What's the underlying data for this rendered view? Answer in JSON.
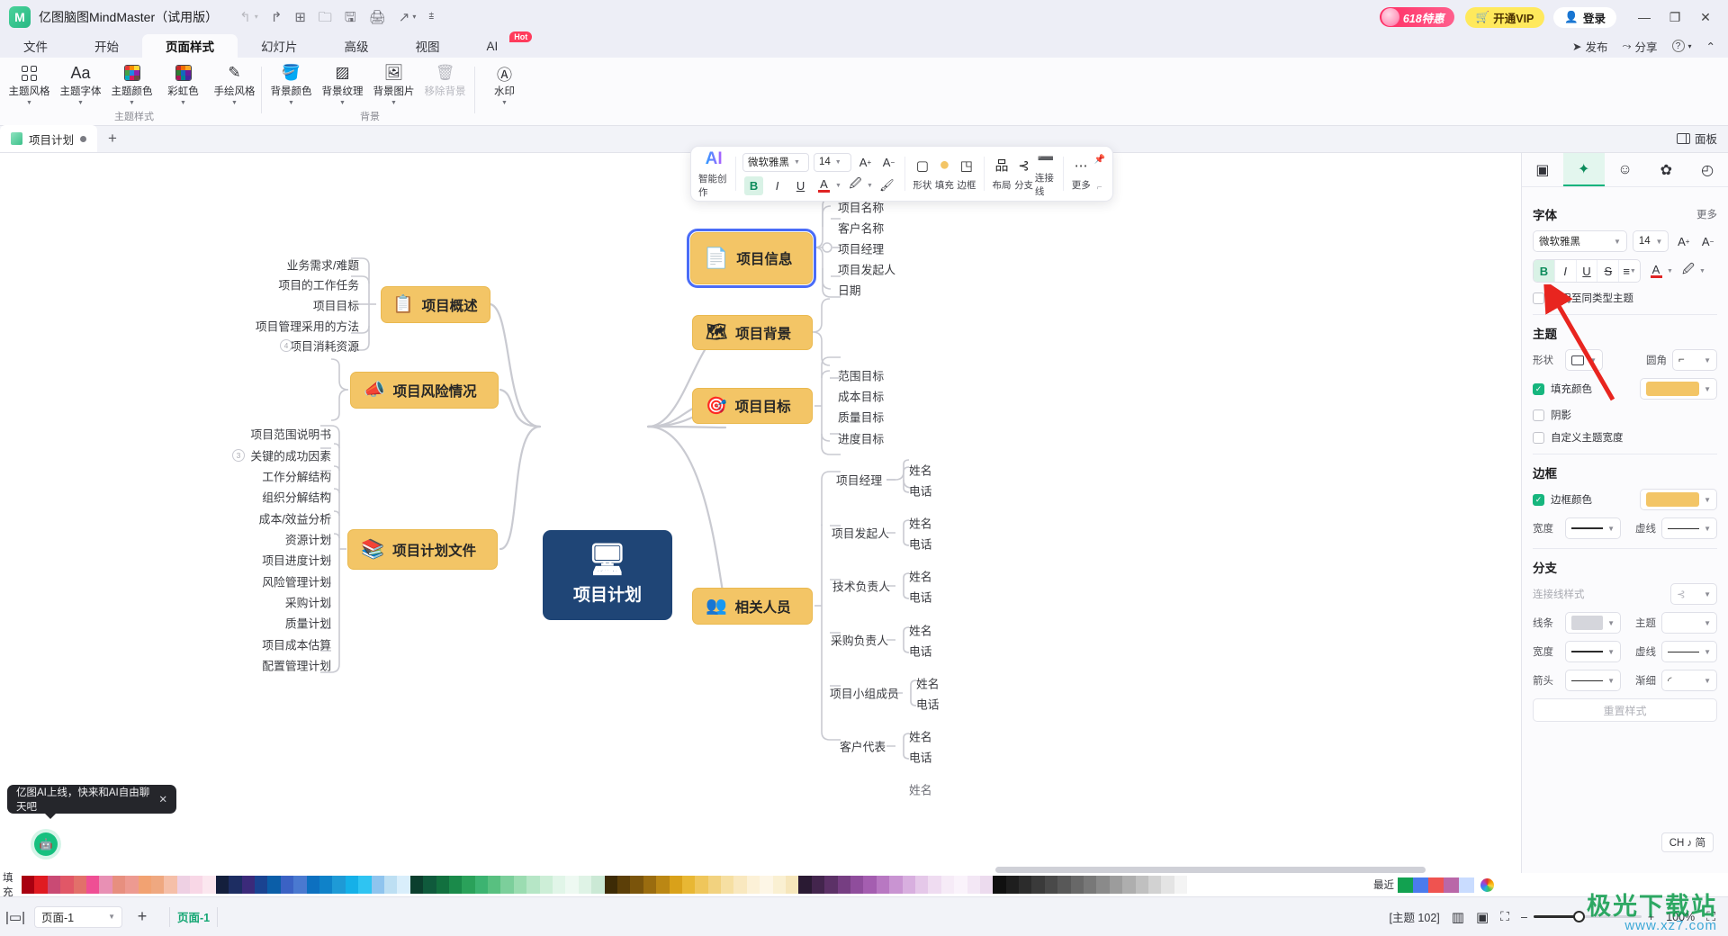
{
  "titlebar": {
    "app_title": "亿图脑图MindMaster（试用版）",
    "logo_glyph": "M",
    "quick_access": [
      {
        "name": "undo",
        "glyph": "↰"
      },
      {
        "name": "undo-dropdown",
        "glyph": "▾"
      },
      {
        "name": "redo",
        "glyph": "↱"
      },
      {
        "name": "new",
        "glyph": "⊞"
      },
      {
        "name": "open",
        "glyph": "🗀"
      },
      {
        "name": "save",
        "glyph": "🖫"
      },
      {
        "name": "print",
        "glyph": "🖨"
      },
      {
        "name": "export",
        "glyph": "↗"
      },
      {
        "name": "export-dropdown",
        "glyph": "▾"
      },
      {
        "name": "more",
        "glyph": "⩲"
      }
    ],
    "promo_badge": "618特惠",
    "vip_button": "开通VIP",
    "vip_icon": "🛒",
    "login_button": "登录",
    "login_icon": "👤",
    "minimize": "—",
    "maximize": "❐",
    "close": "✕"
  },
  "ribbon": {
    "tabs": [
      {
        "label": "文件",
        "active": false
      },
      {
        "label": "开始",
        "active": false
      },
      {
        "label": "页面样式",
        "active": true
      },
      {
        "label": "幻灯片",
        "active": false
      },
      {
        "label": "高级",
        "active": false
      },
      {
        "label": "视图",
        "active": false
      }
    ],
    "ai_tab": {
      "label": "AI",
      "badge": "Hot"
    },
    "right_actions": [
      {
        "label": "发布",
        "icon": "➤"
      },
      {
        "label": "分享",
        "icon": "⤳"
      },
      {
        "label": "",
        "icon": "?"
      },
      {
        "label": "",
        "icon": "▾"
      },
      {
        "label": "",
        "icon": "⌃"
      }
    ],
    "groups": [
      {
        "label": "主题样式",
        "items": [
          {
            "label": "主题风格",
            "icon": "grid-icon",
            "caret": true
          },
          {
            "label": "主题字体",
            "icon": "Aa",
            "caret": true
          },
          {
            "label": "主题颜色",
            "icon": "palette-icon",
            "caret": true
          },
          {
            "label": "彩虹色",
            "icon": "rainbow-icon",
            "caret": true
          },
          {
            "label": "手绘风格",
            "icon": "✎",
            "caret": true
          }
        ]
      },
      {
        "label": "背景",
        "items": [
          {
            "label": "背景颜色",
            "icon": "🪣",
            "caret": true
          },
          {
            "label": "背景纹理",
            "icon": "▨",
            "caret": true
          },
          {
            "label": "背景图片",
            "icon": "🖼",
            "caret": true
          },
          {
            "label": "移除背景",
            "icon": "🗑",
            "caret": false,
            "disabled": true
          }
        ]
      },
      {
        "label": "",
        "items": [
          {
            "label": "水印",
            "icon": "Ⓐ",
            "caret": true
          }
        ]
      }
    ]
  },
  "doctabs": {
    "tabs": [
      {
        "label": "项目计划",
        "modified": true
      }
    ],
    "add_label": "+",
    "panel_toggle": "面板"
  },
  "format_toolbar": {
    "ai_label": "AI",
    "ai_sub": "智能创作",
    "font_family": "微软雅黑",
    "font_size": "14",
    "increase_label": "A",
    "decrease_label": "A",
    "bold": "B",
    "italic": "I",
    "underline": "U",
    "font_color": "A",
    "font_color_hex": "#e02424",
    "highlight": "🖉",
    "painter": "🖌",
    "items": [
      {
        "label": "形状",
        "icon": "▢"
      },
      {
        "label": "填充",
        "icon": "●"
      },
      {
        "label": "边框",
        "icon": "◳"
      },
      {
        "label": "布局",
        "icon": "品"
      },
      {
        "label": "分支",
        "icon": "⊰"
      },
      {
        "label": "连接线",
        "icon": "➖"
      },
      {
        "label": "更多",
        "icon": "⋯"
      }
    ]
  },
  "right_panel": {
    "tabs": [
      {
        "name": "style",
        "icon": "▣",
        "active": false
      },
      {
        "name": "ai-sparkle",
        "icon": "✦",
        "active": true
      },
      {
        "name": "emoji",
        "icon": "☺",
        "active": false
      },
      {
        "name": "settings",
        "icon": "✿",
        "active": false
      },
      {
        "name": "history",
        "icon": "◴",
        "active": false
      }
    ],
    "font_section": {
      "title": "字体",
      "more": "更多",
      "family": "微软雅黑",
      "size": "14",
      "inc": "A",
      "dec": "A",
      "bold": "B",
      "italic": "I",
      "underline": "U",
      "strike": "S",
      "align": "≡",
      "color": "A",
      "highlight": "🖉",
      "apply_same": "应用至同类型主题"
    },
    "theme_section": {
      "title": "主题",
      "shape_label": "形状",
      "corner_label": "圆角",
      "corner_glyph": "⌐",
      "fill_label": "填充颜色",
      "fill_color": "#f3c566",
      "fill_checked": true,
      "shadow_label": "阴影",
      "shadow_checked": false,
      "custom_width_label": "自定义主题宽度",
      "custom_width_checked": false
    },
    "border_section": {
      "title": "边框",
      "color_label": "边框颜色",
      "color": "#f3c566",
      "color_checked": true,
      "width_label": "宽度",
      "dash_label": "虚线"
    },
    "branch_section": {
      "title": "分支",
      "connector_label": "连接线样式",
      "connector_glyph": "⊰",
      "line_label": "线条",
      "theme_label": "主题",
      "width_label": "宽度",
      "dash_label": "虚线",
      "arrow_label": "箭头",
      "taper_label": "渐细",
      "taper_glyph": "◜",
      "reset_label": "重置样式"
    }
  },
  "mindmap": {
    "center": {
      "label": "项目计划",
      "icon": "🖥",
      "color": "#1f4576"
    },
    "topics": [
      {
        "name": "project-info",
        "label": "项目信息",
        "icon": "📄",
        "selected": true,
        "children": [
          "项目名称",
          "客户名称",
          "项目经理",
          "项目发起人",
          "日期"
        ]
      },
      {
        "name": "project-background",
        "label": "项目背景",
        "icon": "🗺",
        "selected": false,
        "children": []
      },
      {
        "name": "project-goal",
        "label": "项目目标",
        "icon": "🎯",
        "selected": false,
        "children": [
          "范围目标",
          "成本目标",
          "质量目标",
          "进度目标"
        ]
      },
      {
        "name": "related-people",
        "label": "相关人员",
        "icon": "👥",
        "selected": false,
        "children": [
          "项目经理",
          "项目发起人",
          "技术负责人",
          "采购负责人",
          "项目小组成员",
          "客户代表"
        ],
        "grandchild": [
          "姓名",
          "电话"
        ]
      },
      {
        "name": "project-overview",
        "label": "项目概述",
        "icon": "📋",
        "selected": false,
        "children": [
          "业务需求/难题",
          "项目的工作任务",
          "项目目标",
          "项目管理采用的方法",
          "项目消耗资源"
        ],
        "badge": {
          "index": 4,
          "text": "4"
        }
      },
      {
        "name": "project-risk",
        "label": "项目风险情况",
        "icon": "📣",
        "selected": false,
        "children": []
      },
      {
        "name": "project-plan-docs",
        "label": "项目计划文件",
        "icon": "📚",
        "selected": false,
        "children": [
          "项目范围说明书",
          "关键的成功因素",
          "工作分解结构",
          "组织分解结构",
          "成本/效益分析",
          "资源计划",
          "项目进度计划",
          "风险管理计划",
          "采购计划",
          "质量计划",
          "项目成本估算",
          "配置管理计划"
        ],
        "badge": {
          "index": 1,
          "text": "3"
        }
      }
    ]
  },
  "toast": {
    "message": "亿图AI上线，快来和AI自由聊天吧",
    "close": "✕",
    "bot_icon": "🤖"
  },
  "palette": {
    "fill_label": "填充",
    "recent_label": "最近",
    "recent_colors": [
      "#12a150",
      "#4b7bec",
      "#ef5350",
      "#b967a8",
      "#c9dcff"
    ],
    "colors": [
      "#a90010",
      "#e01b22",
      "#c94a74",
      "#e15767",
      "#e2706a",
      "#ef4f94",
      "#e890b4",
      "#e78f7f",
      "#ed9a91",
      "#f2a272",
      "#efa880",
      "#f5bfa8",
      "#eed0e3",
      "#f8d7e6",
      "#fbe7ef",
      "#141f3c",
      "#1d2d62",
      "#3b2a7a",
      "#1a4391",
      "#0b5ea8",
      "#3b62c4",
      "#4a79d0",
      "#0d70c0",
      "#0f82c9",
      "#1e9ad6",
      "#15b0e8",
      "#2fc4f2",
      "#8fc4ee",
      "#bddff3",
      "#d9eefb",
      "#0b3f2e",
      "#0f5a3c",
      "#12703f",
      "#1a8a4a",
      "#2aa15a",
      "#3cb371",
      "#58c080",
      "#7ccf9b",
      "#9bdcb1",
      "#b6e6c6",
      "#cdeed7",
      "#e1f5e8",
      "#eef9f2",
      "#dff3e6",
      "#cbe9d5",
      "#3d2b06",
      "#5c3f08",
      "#7a540b",
      "#9a6c0f",
      "#bb8714",
      "#d9a11a",
      "#e8b734",
      "#efc65b",
      "#f2d27f",
      "#f6dfa2",
      "#f9e8bf",
      "#fcf1d7",
      "#fdf6e6",
      "#faf0d2",
      "#f6e6bb",
      "#2a1a33",
      "#43254d",
      "#5c3167",
      "#763e82",
      "#8f4d9c",
      "#a45eb0",
      "#b878c2",
      "#c994d2",
      "#d8afdf",
      "#e5c8e9",
      "#efdcf1",
      "#f6ebf7",
      "#faf3fb",
      "#f3e7f5",
      "#ecdbee",
      "#101010",
      "#1e1e1e",
      "#2c2c2c",
      "#3a3a3a",
      "#494949",
      "#585858",
      "#686868",
      "#787878",
      "#8a8a8a",
      "#9c9c9c",
      "#aeaeae",
      "#c0c0c0",
      "#d2d2d2",
      "#e4e4e4",
      "#f4f4f4"
    ]
  },
  "statusbar": {
    "view_icon": "|▭|",
    "page_select": "页面-1",
    "add": "+",
    "current_page": "页面-1",
    "theme_count": "[主题 102]",
    "view_buttons": [
      "▥",
      "▣",
      "⛶"
    ],
    "zoom_minus": "–",
    "zoom_plus": "+",
    "zoom_value": "100%",
    "fit_icon": "⛶",
    "ime": "CH ♪ 简"
  },
  "watermark": {
    "big": "极光下载站",
    "small": "www.xz7.com"
  }
}
